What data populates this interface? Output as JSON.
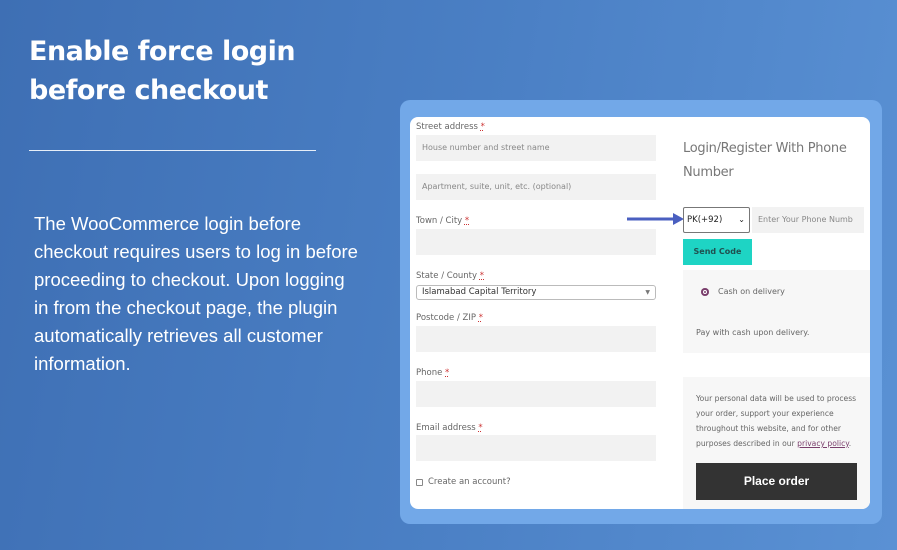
{
  "heading": "Enable force login before checkout",
  "description": "The WooCommerce login before checkout requires users to log in before proceeding to checkout. Upon logging in from the checkout page, the plugin automatically retrieves all customer information.",
  "form": {
    "street_label": "Street address",
    "required": "*",
    "street_placeholder": "House number and street name",
    "apt_placeholder": "Apartment, suite, unit, etc. (optional)",
    "town_label": "Town / City",
    "state_label": "State / County",
    "state_value": "Islamabad Capital Territory",
    "postcode_label": "Postcode / ZIP",
    "phone_label": "Phone",
    "email_label": "Email address",
    "create_account": "Create an account?"
  },
  "login": {
    "title": "Login/Register With Phone Number",
    "country_code": "PK(+92)",
    "phone_placeholder": "Enter Your Phone Numb",
    "send_code": "Send Code"
  },
  "payment": {
    "method": "Cash on delivery",
    "note": "Pay with cash upon delivery."
  },
  "privacy": {
    "text": "Your personal data will be used to process your order, support your experience throughout this website, and for other purposes described in our ",
    "link": "privacy policy",
    "end": "."
  },
  "place_order": "Place order",
  "colors": {
    "send_code": "#1ed4c4",
    "place_order": "#333333",
    "arrow": "#4a5fc0"
  }
}
